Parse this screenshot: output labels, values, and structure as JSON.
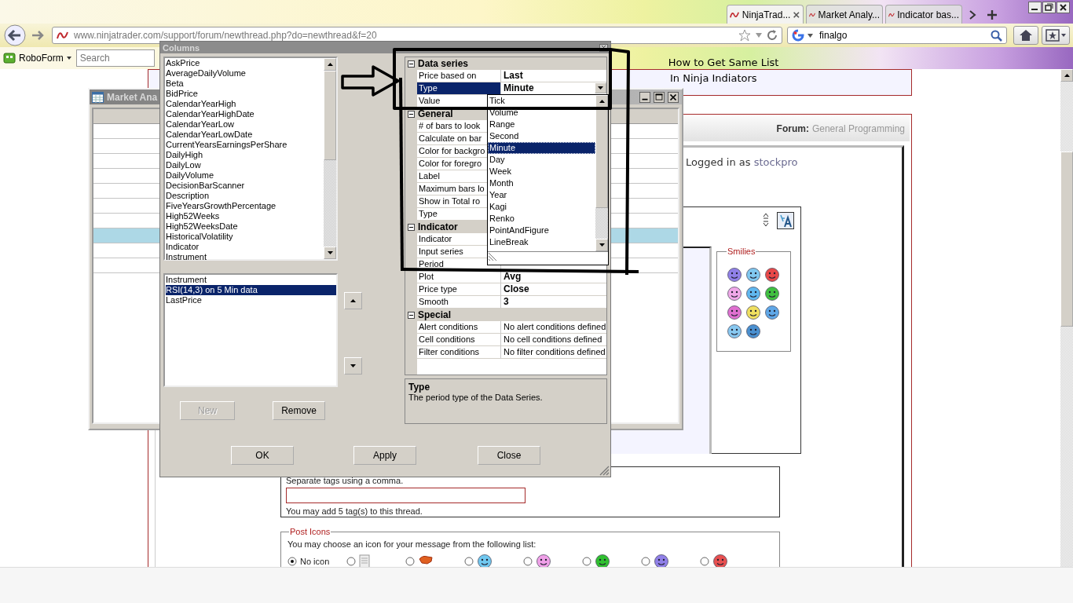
{
  "browser": {
    "tabs": [
      {
        "label": "NinjaTrad...",
        "selected": true
      },
      {
        "label": "Market Analy...",
        "selected": false
      },
      {
        "label": "Indicator bas...",
        "selected": false
      }
    ],
    "url": "www.ninjatrader.com/support/forum/newthread.php?do=newthread&f=20",
    "search_value": "finalgo",
    "roboform": "RoboForm",
    "toolbar_search_placeholder": "Search",
    "thread_title": "How to Get Same List"
  },
  "page": {
    "thread_title_continued": "In Ninja Indiators",
    "forum_label": "Forum:",
    "forum_name": "General Programming",
    "logged_in_label": "Logged in as",
    "username": "stockpro",
    "smilies_legend": "Smilies",
    "smilies": [
      {
        "color": "#9080e8"
      },
      {
        "color": "#80c8f0"
      },
      {
        "color": "#e84848"
      },
      {
        "color": "#f0a8e8"
      },
      {
        "color": "#60b8f0"
      },
      {
        "color": "#40c040"
      },
      {
        "color": "#e070d0"
      },
      {
        "color": "#f0e060"
      },
      {
        "color": "#60a8e8"
      },
      {
        "color": "#88c8f0"
      },
      {
        "color": "#4a90d0"
      }
    ],
    "tags_hint": "Separate tags using a comma.",
    "tags_note": "You may add 5 tag(s) to this thread.",
    "post_icons_legend": "Post Icons",
    "post_icons_text": "You may choose an icon for your message from the following list:",
    "post_icons": [
      {
        "kind": "none",
        "label": "No icon",
        "selected": true
      },
      {
        "kind": "document",
        "selected": false
      },
      {
        "kind": "hand",
        "selected": false
      },
      {
        "kind": "smiley",
        "color": "#70c8f0",
        "selected": false
      },
      {
        "kind": "smiley",
        "color": "#f0a0e8",
        "selected": false
      },
      {
        "kind": "smiley",
        "color": "#30c030",
        "selected": false
      },
      {
        "kind": "smiley",
        "color": "#9080e8",
        "selected": false
      },
      {
        "kind": "smiley",
        "color": "#e85050",
        "selected": false
      }
    ]
  },
  "market_analyzer": {
    "title": "Market Ana",
    "rows": [
      {
        "selected": false
      },
      {
        "selected": false
      },
      {
        "selected": false
      },
      {
        "selected": false
      },
      {
        "selected": false
      },
      {
        "selected": false
      },
      {
        "selected": false
      },
      {
        "selected": true
      },
      {
        "selected": false
      },
      {
        "selected": false
      }
    ]
  },
  "columns_dialog": {
    "title": "Columns",
    "available_columns": [
      "AskPrice",
      "AverageDailyVolume",
      "Beta",
      "BidPrice",
      "CalendarYearHigh",
      "CalendarYearHighDate",
      "CalendarYearLow",
      "CalendarYearLowDate",
      "CurrentYearsEarningsPerShare",
      "DailyHigh",
      "DailyLow",
      "DailyVolume",
      "DecisionBarScanner",
      "Description",
      "FiveYearsGrowthPercentage",
      "High52Weeks",
      "High52WeeksDate",
      "HistoricalVolatility",
      "Indicator",
      "Instrument"
    ],
    "selected_columns": [
      {
        "label": "Instrument",
        "selected": false
      },
      {
        "label": "RSI(14,3) on 5 Min data",
        "selected": true
      },
      {
        "label": "LastPrice",
        "selected": false
      }
    ],
    "list_buttons": [
      {
        "label": "New",
        "disabled": true
      },
      {
        "label": "Remove",
        "disabled": false
      }
    ],
    "properties": [
      {
        "group": "Data series",
        "expanded": true,
        "rows": [
          {
            "name": "Price based on",
            "value": "Last",
            "selected": false
          },
          {
            "name": "Type",
            "value": "Minute",
            "selected": true,
            "kind": "dropdown"
          },
          {
            "name": "Value",
            "selected": false
          }
        ]
      },
      {
        "group": "General",
        "expanded": true,
        "rows": [
          {
            "name": "# of bars to look",
            "selected": false
          },
          {
            "name": "Calculate on bar",
            "selected": false
          },
          {
            "name": "Color for backgro",
            "selected": false
          },
          {
            "name": "Color for foregro",
            "selected": false
          },
          {
            "name": "Label",
            "selected": false
          },
          {
            "name": "Maximum bars lo",
            "selected": false
          },
          {
            "name": "Show in Total ro",
            "selected": false
          },
          {
            "name": "Type",
            "selected": false
          }
        ]
      },
      {
        "group": "Indicator",
        "expanded": true,
        "rows": [
          {
            "name": "Indicator",
            "selected": false
          },
          {
            "name": "Input series",
            "selected": false
          },
          {
            "name": "Period",
            "selected": false
          },
          {
            "name": "Plot",
            "value": "Avg",
            "selected": false
          },
          {
            "name": "Price type",
            "value": "Close",
            "selected": false
          },
          {
            "name": "Smooth",
            "value": "3",
            "selected": false
          }
        ]
      },
      {
        "group": "Special",
        "expanded": true,
        "rows": [
          {
            "name": "Alert conditions",
            "value": "No alert conditions defined",
            "selected": false
          },
          {
            "name": "Cell conditions",
            "value": "No cell conditions defined",
            "selected": false
          },
          {
            "name": "Filter conditions",
            "value": "No filter conditions defined",
            "selected": false
          }
        ]
      }
    ],
    "type_dropdown": [
      {
        "label": "Tick",
        "selected": false
      },
      {
        "label": "Volume",
        "selected": false
      },
      {
        "label": "Range",
        "selected": false
      },
      {
        "label": "Second",
        "selected": false
      },
      {
        "label": "Minute",
        "selected": true
      },
      {
        "label": "Day",
        "selected": false
      },
      {
        "label": "Week",
        "selected": false
      },
      {
        "label": "Month",
        "selected": false
      },
      {
        "label": "Year",
        "selected": false
      },
      {
        "label": "Kagi",
        "selected": false
      },
      {
        "label": "Renko",
        "selected": false
      },
      {
        "label": "PointAndFigure",
        "selected": false
      },
      {
        "label": "LineBreak",
        "selected": false
      }
    ],
    "description": {
      "title": "Type",
      "text": "The period type of the Data Series."
    },
    "dialog_buttons": [
      "OK",
      "Apply",
      "Close"
    ]
  }
}
